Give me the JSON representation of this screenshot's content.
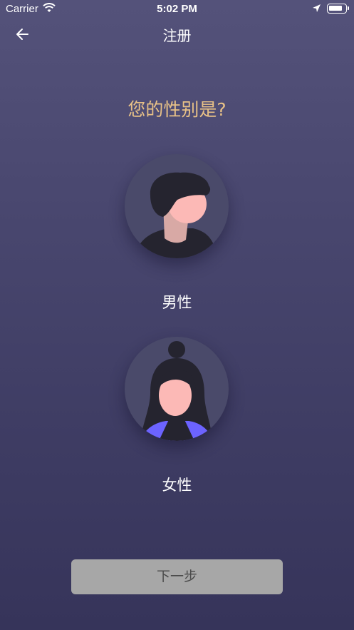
{
  "status_bar": {
    "carrier": "Carrier",
    "time": "5:02 PM"
  },
  "nav": {
    "title": "注册",
    "back_icon": "arrow-left-icon"
  },
  "question": "您的性别是?",
  "options": [
    {
      "label": "男性",
      "avatar": "male-avatar"
    },
    {
      "label": "女性",
      "avatar": "female-avatar"
    }
  ],
  "next_button": "下一步",
  "colors": {
    "accent": "#e8c187",
    "button_bg": "#a7a7a7"
  }
}
